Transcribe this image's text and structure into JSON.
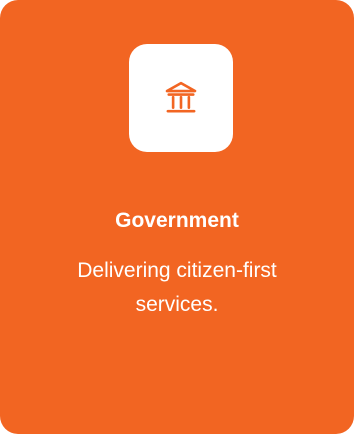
{
  "card": {
    "icon": "government-building-icon",
    "title": "Government",
    "description": "Delivering citizen-first services."
  },
  "colors": {
    "background": "#f26522",
    "tile": "#ffffff",
    "text": "#ffffff"
  }
}
